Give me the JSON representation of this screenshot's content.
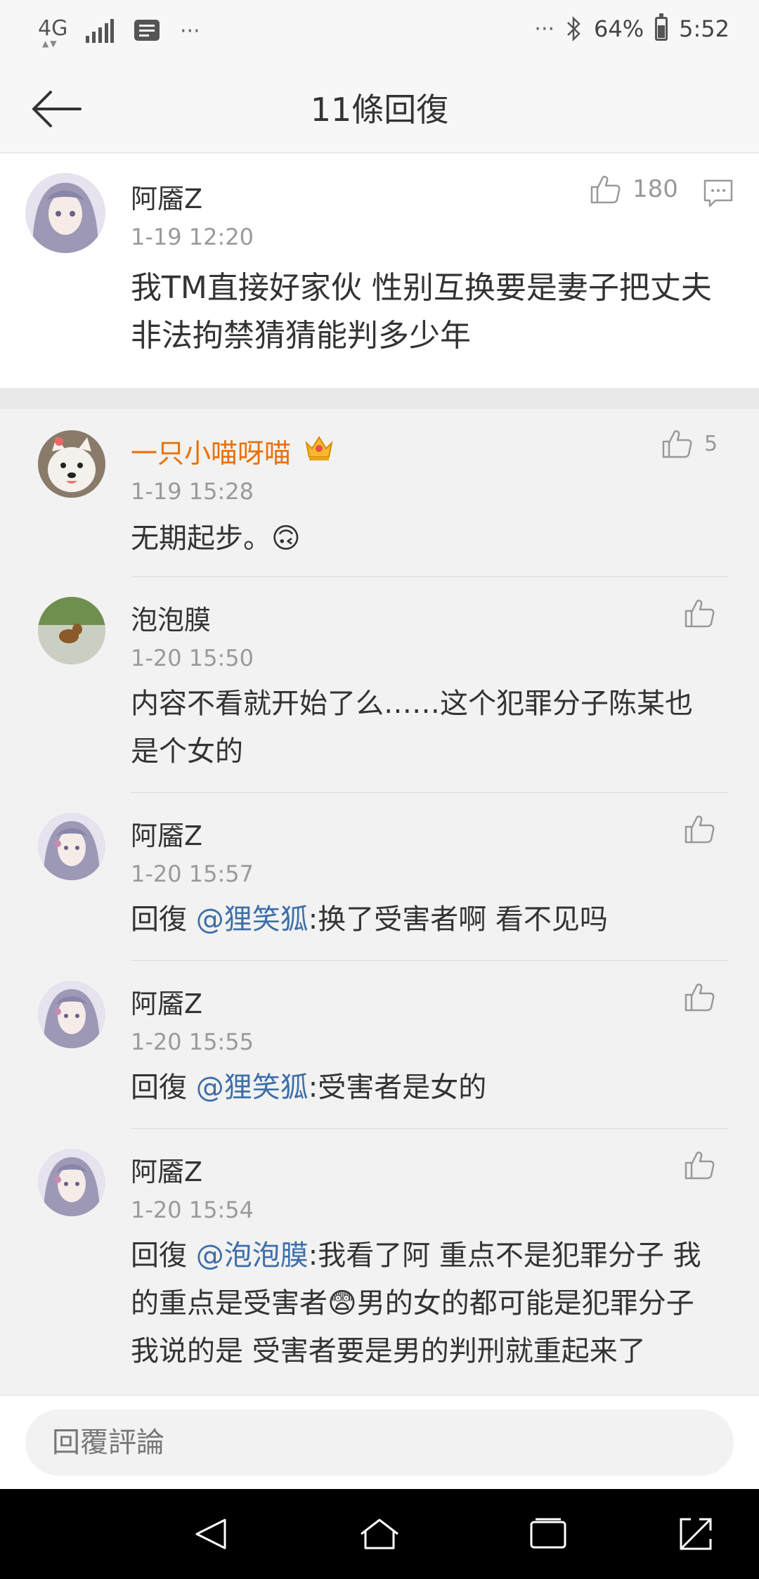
{
  "status_bar": {
    "network": "4G",
    "battery_percent": "64%",
    "battery_level": 0.64,
    "time": "5:52",
    "more_left": "···",
    "more_right": "···"
  },
  "header": {
    "title": "11條回復"
  },
  "main_comment": {
    "author": "阿靥Z",
    "time": "1-19 12:20",
    "likes": "180",
    "content": "我TM直接好家伙 性别互换要是妻子把丈夫非法拘禁猜猜能判多少年"
  },
  "replies": [
    {
      "author": "一只小喵呀喵",
      "author_color": "#e8710a",
      "time": "1-19 15:28",
      "likes": "5",
      "content": "无期起步。🙃"
    },
    {
      "author": "泡泡膜",
      "time": "1-20 15:50",
      "likes": "",
      "content": "内容不看就开始了么……这个犯罪分子陈某也是个女的"
    },
    {
      "author": "阿靥Z",
      "time": "1-20 15:57",
      "likes": "",
      "reply_prefix": "回復 ",
      "mention": "@狸笑狐",
      "content": ":换了受害者啊 看不见吗"
    },
    {
      "author": "阿靥Z",
      "time": "1-20 15:55",
      "likes": "",
      "reply_prefix": "回復 ",
      "mention": "@狸笑狐",
      "content": ":受害者是女的"
    },
    {
      "author": "阿靥Z",
      "time": "1-20 15:54",
      "likes": "",
      "reply_prefix": "回復 ",
      "mention": "@泡泡膜",
      "content_part1": ":我看了阿 重点不是犯罪分子 我的重点是受害者",
      "content_emoji": "😨",
      "content_part2": "男的女的都可能是犯罪分子 我说的是 受害者要是男的判刑就重起来了"
    }
  ],
  "input": {
    "placeholder": "回覆評論"
  },
  "icons": {
    "back": "arrow-left-icon",
    "like": "thumbs-up-icon",
    "comment": "comment-icon",
    "crown": "crown-badge-icon"
  }
}
